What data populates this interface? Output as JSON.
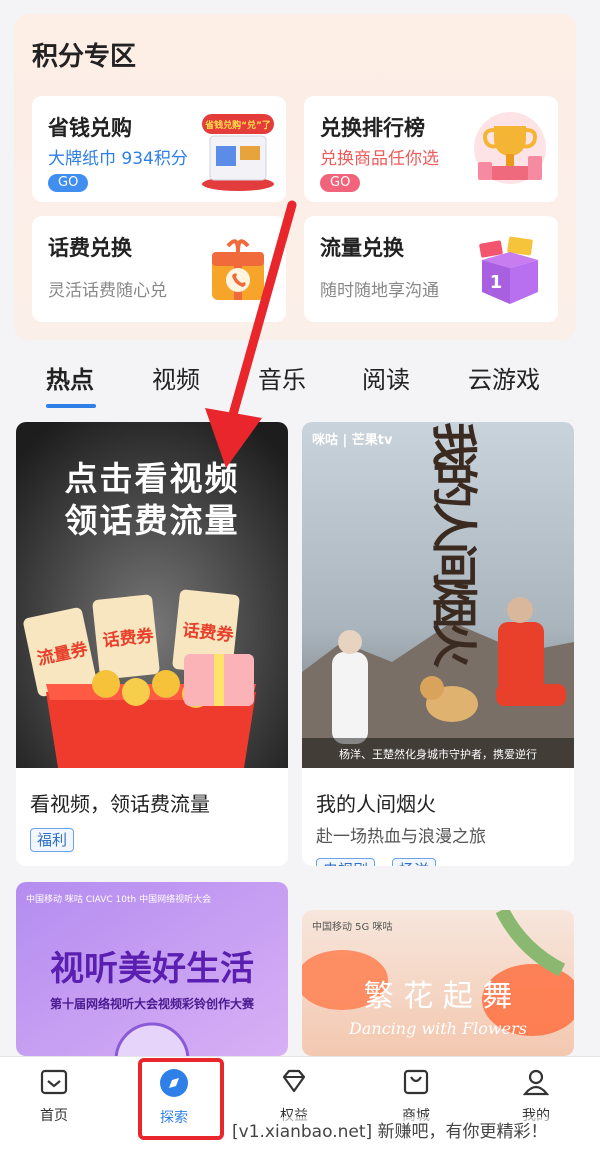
{
  "points_section": {
    "title": "积分专区",
    "cards": [
      {
        "title": "省钱兑购",
        "subtitle": "大牌纸巾 934积分",
        "button": "GO"
      },
      {
        "title": "兑换排行榜",
        "subtitle": "兑换商品任你选",
        "button": "GO"
      },
      {
        "title": "话费兑换",
        "subtitle": "灵活话费随心兑"
      },
      {
        "title": "流量兑换",
        "subtitle": "随时随地享沟通"
      }
    ],
    "promo_sticker": "省钱兑购“兑”了"
  },
  "tabs": [
    "热点",
    "视频",
    "音乐",
    "阅读",
    "云游戏"
  ],
  "active_tab": "热点",
  "feed": [
    {
      "image_text_line1": "点击看视频",
      "image_text_line2": "领话费流量",
      "coupon1": "流量券",
      "coupon2": "话费券",
      "coupon3": "话费券",
      "title": "看视频，领话费流量",
      "tags": [
        "福利"
      ]
    },
    {
      "logo": "咪咕 | 芒果tv",
      "poster_title": "我的人间烟火",
      "poster_caption": "杨洋、王楚然化身城市守护者，携爱逆行",
      "title": "我的人间烟火",
      "subtitle": "赴一场热血与浪漫之旅",
      "tags": [
        "电视剧",
        "杨洋"
      ]
    },
    {
      "logo": "中国移动 咪咕 CIAVC 10th 中国网络视听大会",
      "headline": "视听美好生活",
      "subhead": "第十届网络视听大会视频彩铃创作大赛"
    },
    {
      "logo": "中国移动 5G 咪咕",
      "headline": "繁 花 起 舞",
      "script": "Dancing with Flowers"
    }
  ],
  "nav": [
    {
      "label": "首页",
      "icon": "home-icon"
    },
    {
      "label": "探索",
      "icon": "compass-icon"
    },
    {
      "label": "权益",
      "icon": "diamond-icon"
    },
    {
      "label": "商城",
      "icon": "bag-icon"
    },
    {
      "label": "我的",
      "icon": "person-icon"
    }
  ],
  "active_nav": "探索",
  "watermark": "[v1.xianbao.net] 新赚吧，有你更精彩！",
  "colors": {
    "accent": "#2f7fe8",
    "annotation": "#e8262b",
    "panel_bg": "#fdeee6"
  }
}
